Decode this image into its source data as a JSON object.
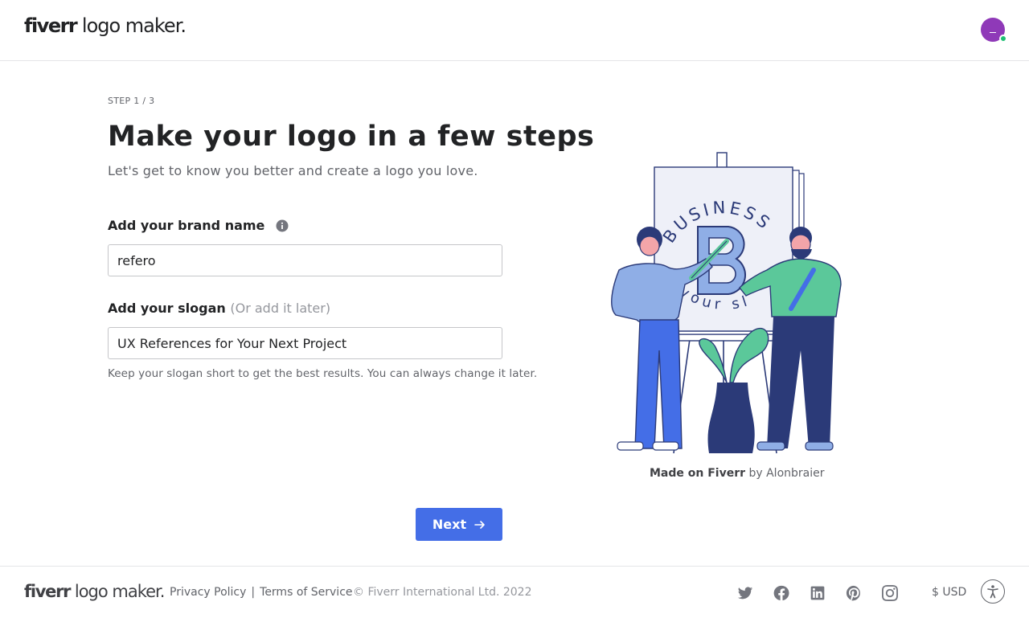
{
  "header": {
    "logo_brand": "fiverr",
    "logo_rest": " logo maker."
  },
  "form": {
    "step": "STEP 1 / 3",
    "title": "Make your logo in a few steps",
    "subtitle": "Let's get to know you better and create a logo you love.",
    "brand_label": "Add your brand name",
    "brand_value": "refero",
    "slogan_label": "Add your slogan",
    "slogan_optional": "(Or add it later)",
    "slogan_value": "UX References for Your Next Project",
    "hint": "Keep your slogan short to get the best results. You can always change it later.",
    "next_label": "Next"
  },
  "illustration": {
    "arc_text": "BUSINESS NAME",
    "slogan_arc": "your slog",
    "credit_bold": "Made on Fiverr",
    "credit_rest": " by Alonbraier"
  },
  "footer": {
    "logo_brand": "fiverr",
    "logo_rest": " logo maker.",
    "privacy": "Privacy Policy",
    "separator": "|",
    "terms": "Terms of Service",
    "copyright": "© Fiverr International Ltd. 2022",
    "currency": "$ USD"
  },
  "icons": [
    "info-icon",
    "arrow-right-icon",
    "twitter-icon",
    "facebook-icon",
    "linkedin-icon",
    "pinterest-icon",
    "instagram-icon",
    "accessibility-icon"
  ],
  "colors": {
    "primary_button": "#446ee7",
    "avatar": "#8f39b8",
    "online": "#1dbf73",
    "illustration_navy": "#2b3a78",
    "illustration_blue": "#8faee6",
    "illustration_green": "#5bc89a"
  }
}
